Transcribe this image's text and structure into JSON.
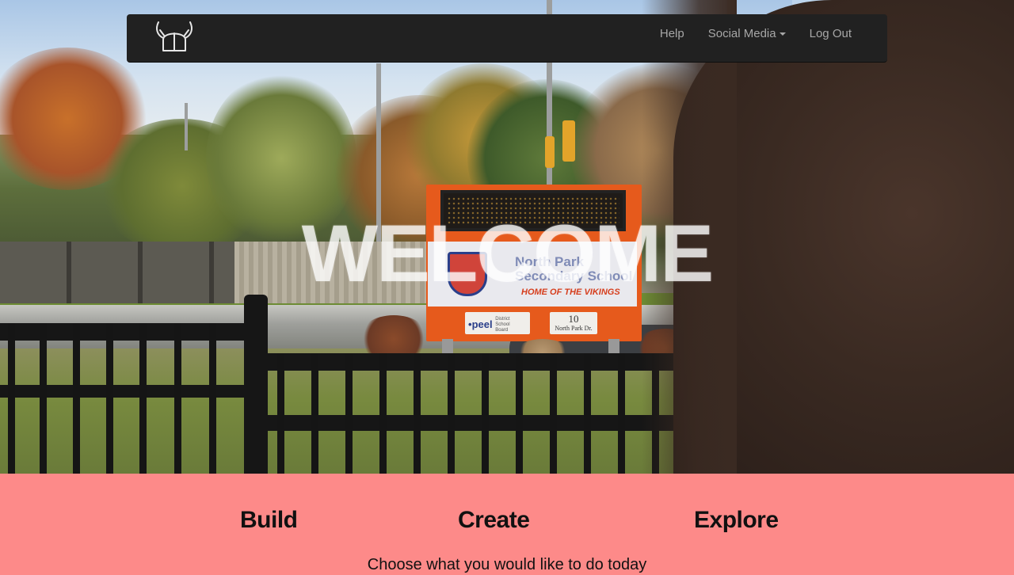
{
  "hero": {
    "heading": "WELCOME",
    "sign": {
      "name": "North Park Secondary School",
      "tagline": "HOME OF THE VIKINGS",
      "board": "peel",
      "board_sub": "District School Board",
      "address_number": "10",
      "address_street": "North Park Dr."
    }
  },
  "navbar": {
    "brand_icon": "viking-helmet-icon",
    "items": [
      {
        "label": "Help"
      },
      {
        "label": "Social Media",
        "has_dropdown": true
      },
      {
        "label": "Log Out"
      }
    ]
  },
  "actions": {
    "build": "Build",
    "create": "Create",
    "explore": "Explore",
    "tagline": "Choose what you would like to do today"
  },
  "colors": {
    "navbar_bg": "#212121",
    "nav_text": "#a7a7a7",
    "band_bg": "#fd8a89",
    "action_text": "#111111"
  }
}
